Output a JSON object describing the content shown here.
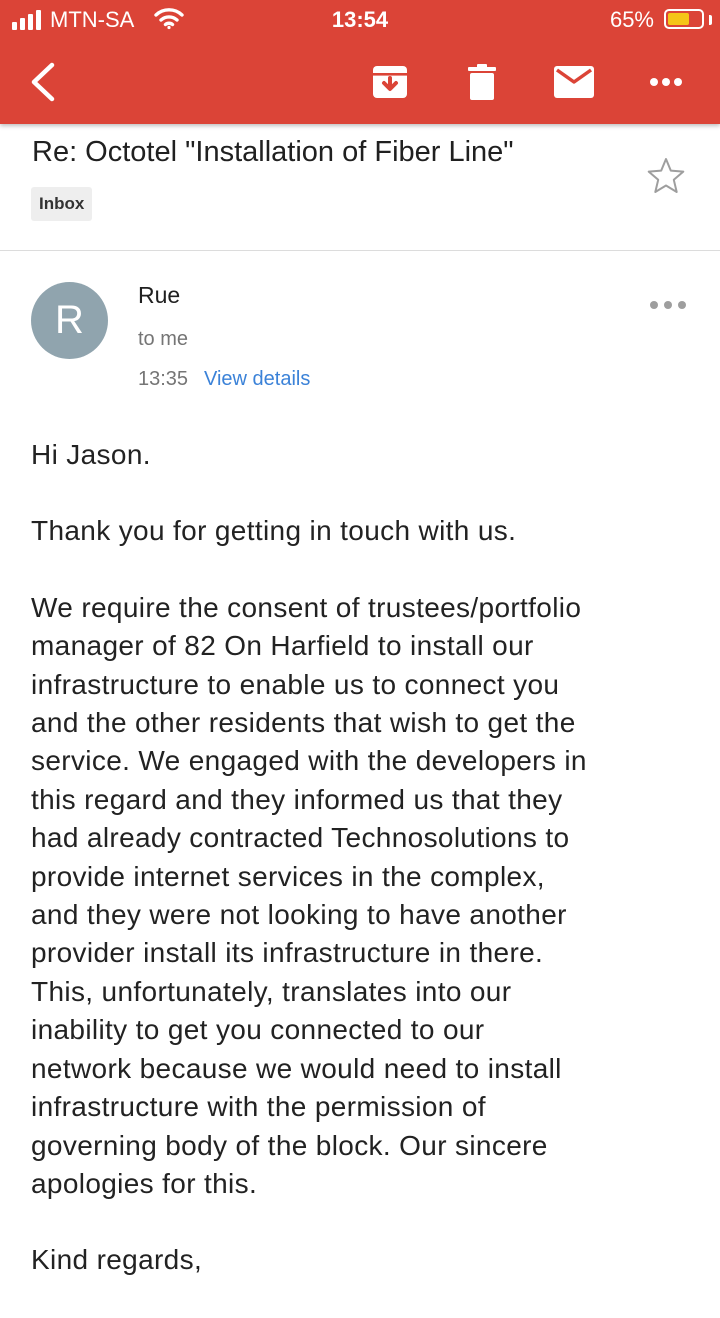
{
  "status_bar": {
    "carrier": "MTN-SA",
    "time": "13:54",
    "battery": "65%",
    "battery_level": 0.65
  },
  "toolbar": {
    "back_icon": "back-arrow-icon",
    "archive_icon": "archive-icon",
    "delete_icon": "trash-icon",
    "mark_unread_icon": "mail-icon",
    "more_icon": "more-horizontal-icon"
  },
  "email": {
    "subject": "Re: Octotel \"Installation of Fiber Line\"",
    "label": "Inbox",
    "sender_initial": "R",
    "sender_name": "Rue",
    "recipient": "to me",
    "time": "13:35",
    "view_details": "View details",
    "body": [
      "Hi Jason.",
      "Thank you for getting in touch with us.",
      "We require the consent of trustees/portfolio\nmanager of 82 On Harfield to install our\ninfrastructure to enable us to connect you\nand the other residents that wish to get the\nservice. We engaged with the developers in\nthis regard and they informed us that they\nhad already contracted Technosolutions to\nprovide internet services in the complex,\nand they were not looking to have another\nprovider install its infrastructure in there.\nThis, unfortunately, translates into our\ninability to get you connected to our\nnetwork because we would need to install\ninfrastructure with the permission of\ngoverning body of the block. Our sincere\napologies for this.",
      "Kind regards,"
    ]
  },
  "colors": {
    "app_bar": "#db4437",
    "link": "#3b82d8",
    "avatar": "#90a4ae"
  }
}
